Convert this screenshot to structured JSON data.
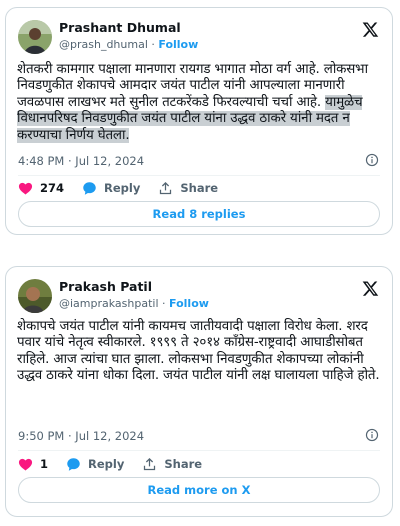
{
  "tweets": [
    {
      "name": "Prashant Dhumal",
      "handle": "@prash_dhumal",
      "separator": "·",
      "follow": "Follow",
      "text_plain": "शेतकरी कामगार पक्षाला मानणारा रायगड भागात मोठा वर्ग आहे. लोकसभा निवडणुकीत शेकापचे आमदार जयंत पाटील यांनी आपल्याला मानणारी जवळपास लाखभर मते सुनील तटकरेंकडे फिरवल्याची चर्चा आहे. ",
      "text_highlight": "यामुळेच विधानपरिषद निवडणुकीत जयंत पाटील यांना उद्धव ठाकरे यांनी मदत न करण्याचा निर्णय घेतला.",
      "timestamp": "4:48 PM · Jul 12, 2024",
      "likes": "274",
      "reply_label": "Reply",
      "share_label": "Share",
      "button_label": "Read 8 replies"
    },
    {
      "name": "Prakash Patil",
      "handle": "@iamprakashpatil",
      "separator": "·",
      "follow": "Follow",
      "text_plain": "शेकापचे जयंत पाटील यांनी कायमच जातीयवादी पक्षाला विरोध केला. शरद पवार यांचे नेतृत्व स्वीकारले. १९९९ ते २०१४ कॉंग्रेस-राष्ट्रवादी आघाडीसोबत राहिले. आज त्यांचा घात झाला. लोकसभा निवडणुकीत शेकापच्या लोकांनी उद्धव ठाकरे यांना धोका दिला. जयंत पाटील यांनी लक्ष घालायला पाहिजे होते.",
      "timestamp": "9:50 PM · Jul 12, 2024",
      "likes": "1",
      "reply_label": "Reply",
      "share_label": "Share",
      "button_label": "Read more on X"
    }
  ],
  "colors": {
    "accent": "#1d9bf0",
    "like": "#f91880",
    "highlight": "#c9cfd3",
    "border": "#cfd9de",
    "muted": "#536471"
  },
  "icons": [
    "x-logo-icon",
    "info-icon",
    "heart-icon",
    "reply-bubble-icon",
    "share-icon",
    "avatar"
  ]
}
